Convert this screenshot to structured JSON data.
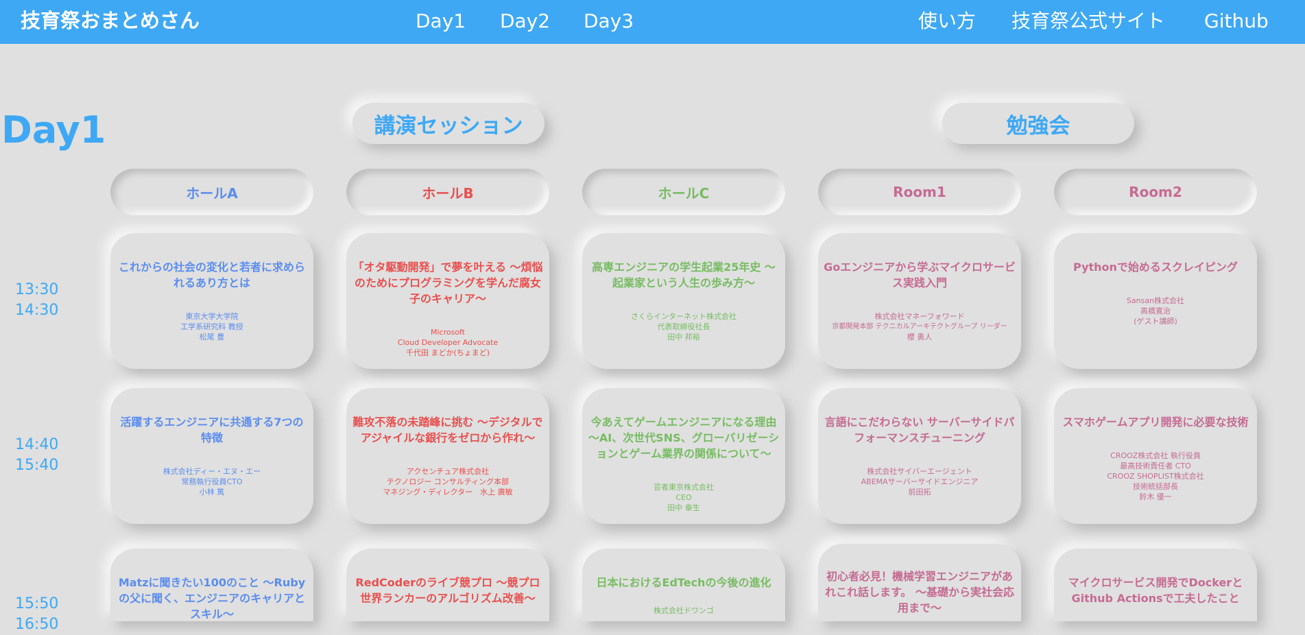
{
  "nav": {
    "brand": "技育祭おまとめさん",
    "days": [
      "Day1",
      "Day2",
      "Day3"
    ],
    "right": [
      "使い方",
      "技育祭公式サイト",
      "Github"
    ]
  },
  "day_title": "Day1",
  "categories": [
    "講演セッション",
    "勉強会"
  ],
  "halls": [
    "ホールA",
    "ホールB",
    "ホールC",
    "Room1",
    "Room2"
  ],
  "colors": {
    "accent": "#3ea8f5",
    "background": "#e0e0e0",
    "hall_a": "#5b8def",
    "hall_b": "#e8504f",
    "hall_c": "#77bc62",
    "room": "#c56b92"
  },
  "slots": [
    {
      "start": "13:30",
      "end": "14:30",
      "sessions": [
        {
          "title": "これからの社会の変化と若者に求められるあり方とは",
          "speaker": [
            "東京大学大学院",
            "工学系研究科 教授",
            "松尾 豊"
          ]
        },
        {
          "title": "「オタ駆動開発」で夢を叶える ～煩悩のためにプログラミングを学んだ腐女子のキャリア～",
          "speaker": [
            "Microsoft",
            "Cloud Developer Advocate",
            "千代田 まどか(ちょまど)"
          ]
        },
        {
          "title": "高専エンジニアの学生起業25年史 ～起業家という人生の歩み方～",
          "speaker": [
            "さくらインターネット株式会社",
            "代表取締役社長",
            "田中 邦裕"
          ]
        },
        {
          "title": "Goエンジニアから学ぶマイクロサービス実践入門",
          "speaker": [
            "株式会社マネーフォワード",
            "京都開発本部 テクニカルアーキテクトグループ リーダー",
            "櫻 勇人"
          ]
        },
        {
          "title": "Pythonで始めるスクレイピング",
          "speaker": [
            "Sansan株式会社",
            "高橋寛治",
            "(ゲスト講師)"
          ]
        }
      ]
    },
    {
      "start": "14:40",
      "end": "15:40",
      "sessions": [
        {
          "title": "活躍するエンジニアに共通する7つの特徴",
          "speaker": [
            "株式会社ディー・エヌ・エー",
            "常務執行役員CTO",
            "小林 篤"
          ]
        },
        {
          "title": "難攻不落の未踏峰に挑む ～デジタルでアジャイルな銀行をゼロから作れ～",
          "speaker": [
            "アクセンチュア株式会社",
            "テクノロジー コンサルティング本部",
            "マネジング・ディレクター　水上 廣敏"
          ]
        },
        {
          "title": "今あえてゲームエンジニアになる理由 ～AI、次世代SNS、グローバリゼーションとゲーム業界の関係について～",
          "speaker": [
            "芸者東京株式会社",
            "CEO",
            "田中 泰生"
          ]
        },
        {
          "title": "言語にこだわらない サーバーサイドパフォーマンスチューニング",
          "speaker": [
            "株式会社サイバーエージェント",
            "ABEMAサーバーサイドエンジニア",
            "前田拓"
          ]
        },
        {
          "title": "スマホゲームアプリ開発に必要な技術",
          "speaker": [
            "CROOZ株式会社 執行役員",
            "最高技術責任者 CTO",
            "CROOZ SHOPLIST株式会社",
            "技術統括部長",
            "鈴木 優一"
          ]
        }
      ]
    },
    {
      "start": "15:50",
      "end": "16:50",
      "sessions": [
        {
          "title": "Matzに聞きたい100のこと ～Rubyの父に聞く、エンジニアのキャリアとスキル～",
          "speaker": []
        },
        {
          "title": "RedCoderのライブ競プロ ～競プロ世界ランカーのアルゴリズム改善～",
          "speaker": []
        },
        {
          "title": "日本におけるEdTechの今後の進化",
          "speaker": [
            "株式会社ドワンゴ"
          ]
        },
        {
          "title": "初心者必見！機械学習エンジニアがあれこれ話します。 ～基礎から実社会応用まで～",
          "speaker": []
        },
        {
          "title": "マイクロサービス開発でDockerとGithub Actionsで工夫したこと",
          "speaker": []
        }
      ]
    }
  ]
}
